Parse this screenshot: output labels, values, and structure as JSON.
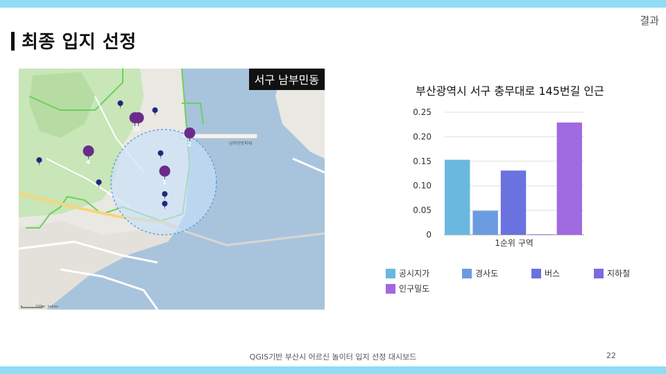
{
  "header": {
    "section_label": "결과",
    "title": "최종 입지 선정"
  },
  "map": {
    "badge": "서구 남부민동",
    "markers": [
      {
        "label": "1"
      },
      {
        "label": "2"
      },
      {
        "label": "3"
      },
      {
        "label": "4"
      },
      {
        "label": "5"
      }
    ],
    "labels": {
      "road": "남부민방파제",
      "scale": "100m",
      "attribution": "kakao"
    }
  },
  "chart_data": {
    "type": "bar",
    "title": "부산광역시 서구 충무대로 145번길 인근",
    "categories": [
      "1순위 구역"
    ],
    "series": [
      {
        "name": "공시지가",
        "values": [
          0.153
        ],
        "color": "#6ab8e0"
      },
      {
        "name": "경사도",
        "values": [
          0.049
        ],
        "color": "#6a9be0"
      },
      {
        "name": "버스",
        "values": [
          0.131
        ],
        "color": "#6a72e0"
      },
      {
        "name": "지하철",
        "values": [
          0.001
        ],
        "color": "#7c6ae0"
      },
      {
        "name": "인구밀도",
        "values": [
          0.229
        ],
        "color": "#a06ae0"
      }
    ],
    "ylim": [
      0,
      0.25
    ],
    "yticks": [
      "0",
      "0.05",
      "0.10",
      "0.15",
      "0.20",
      "0.25"
    ],
    "ytick_values": [
      0,
      0.05,
      0.1,
      0.15,
      0.2,
      0.25
    ],
    "grid": true,
    "legend": "bottom"
  },
  "footer": {
    "text": "QGIS기반 부산시 어르신 놀이터 입지 선정 대시보드",
    "page": "22"
  }
}
